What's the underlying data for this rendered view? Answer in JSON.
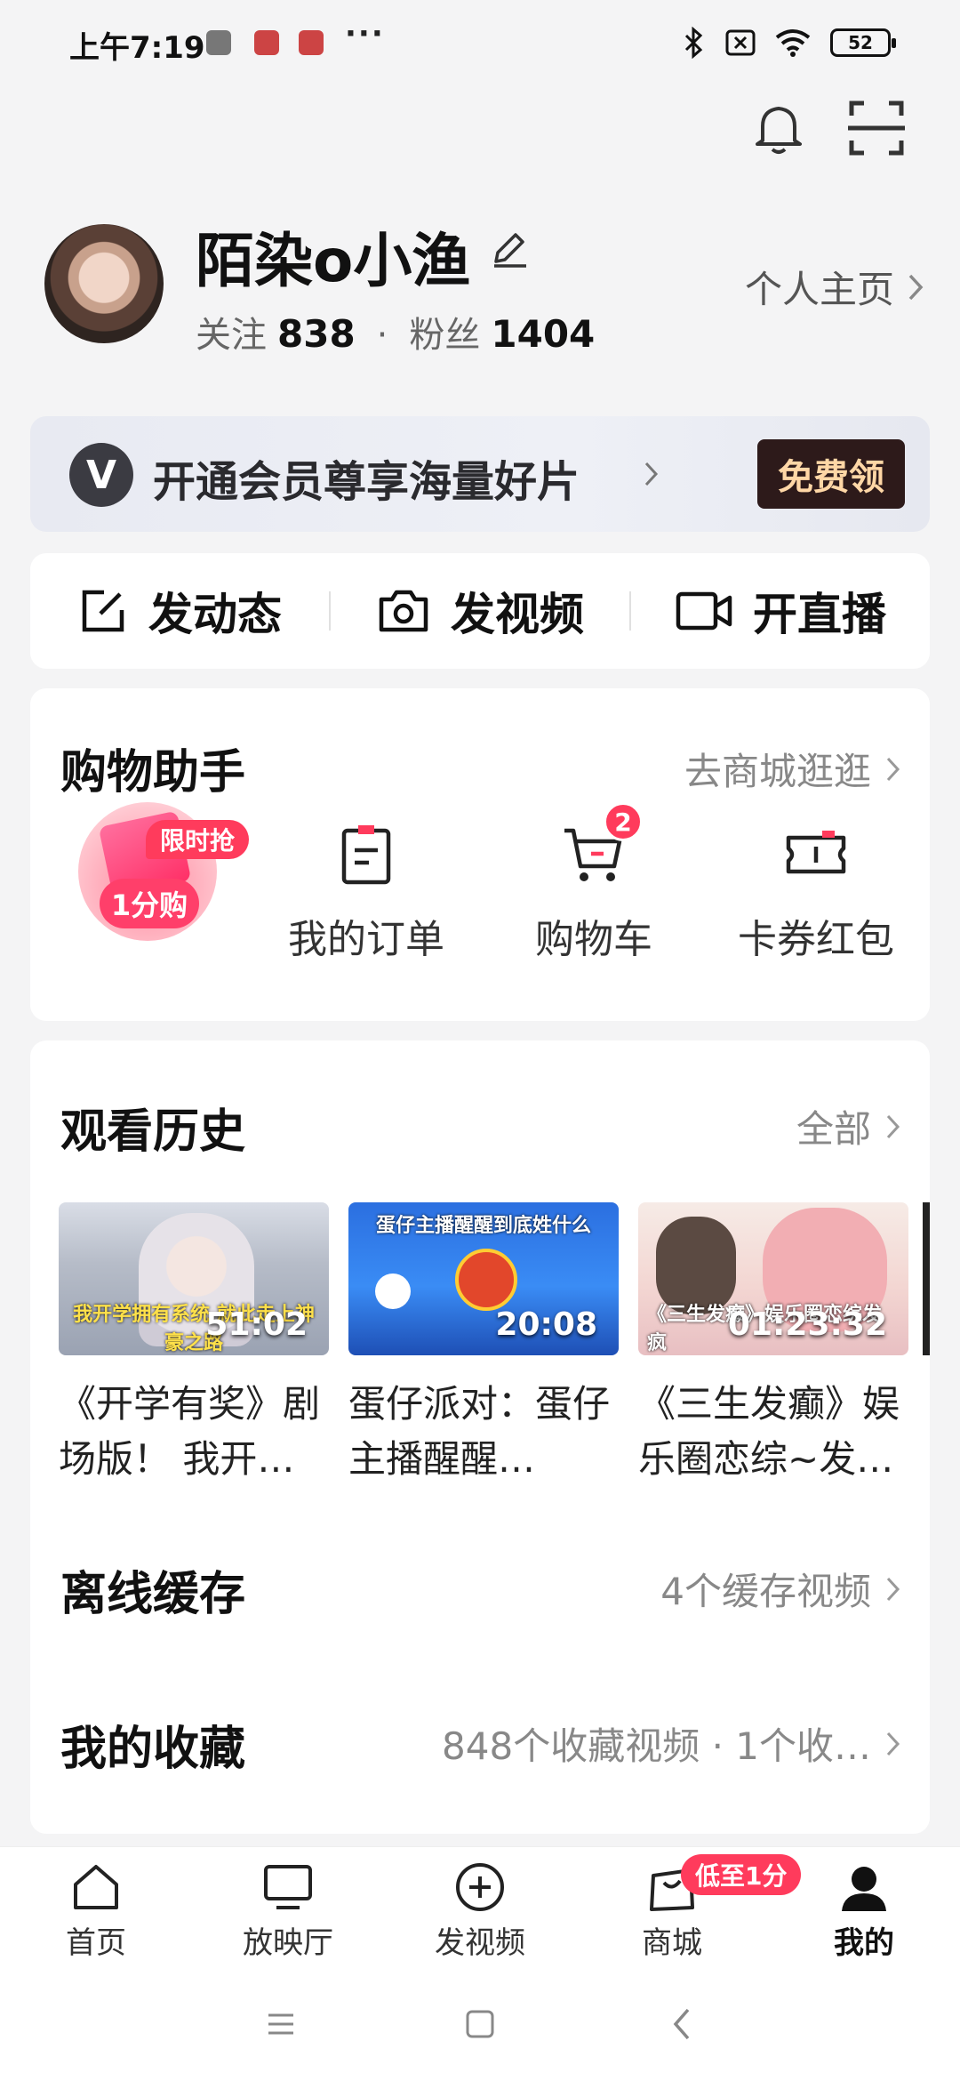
{
  "status_bar": {
    "time": "上午7:19",
    "more": "···",
    "battery": "52"
  },
  "profile": {
    "username": "陌染o小渔",
    "following_label": "关注",
    "following_count": "838",
    "separator": "·",
    "followers_label": "粉丝",
    "followers_count": "1404",
    "homepage_link": "个人主页"
  },
  "vip_banner": {
    "logo_letter": "V",
    "text": "开通会员尊享海量好片",
    "button": "免费领"
  },
  "actions": {
    "post": "发动态",
    "upload_video": "发视频",
    "live": "开直播"
  },
  "shopping": {
    "title": "购物助手",
    "link": "去商城逛逛",
    "promo_label": "1分购",
    "promo_tag": "限时抢",
    "items": [
      {
        "label": "我的订单",
        "icon": "order-icon"
      },
      {
        "label": "购物车",
        "icon": "cart-icon",
        "badge": "2"
      },
      {
        "label": "卡券红包",
        "icon": "coupon-icon"
      }
    ]
  },
  "history": {
    "title": "观看历史",
    "link": "全部",
    "videos": [
      {
        "title": "《开学有奖》剧场版！ 我开…",
        "duration": "51:02",
        "caption": "我开学拥有系统 就此走上神豪之路"
      },
      {
        "title": "蛋仔派对：蛋仔主播醒醒…",
        "duration": "20:08",
        "caption": "蛋仔主播醒醒到底姓什么"
      },
      {
        "title": "《三生发癫》娱乐圈恋综~发…",
        "duration": "01:23:32",
        "caption": "《三生发癫》娱乐圈恋综发疯"
      }
    ]
  },
  "offline": {
    "title": "离线缓存",
    "link": "4个缓存视频"
  },
  "favorites": {
    "title": "我的收藏",
    "link": "848个收藏视频 · 1个收…"
  },
  "tab_bar": {
    "tabs": [
      {
        "label": "首页",
        "icon": "home-icon"
      },
      {
        "label": "放映厅",
        "icon": "tv-icon"
      },
      {
        "label": "发视频",
        "icon": "plus-circle-icon"
      },
      {
        "label": "商城",
        "icon": "shopping-bag-icon",
        "badge": "低至1分"
      },
      {
        "label": "我的",
        "icon": "profile-icon"
      }
    ],
    "active": "我的"
  },
  "colors": {
    "accent": "#ff3b5c",
    "vip_button_bg": "#2d1a1a",
    "vip_button_text": "#ffd7a6"
  }
}
